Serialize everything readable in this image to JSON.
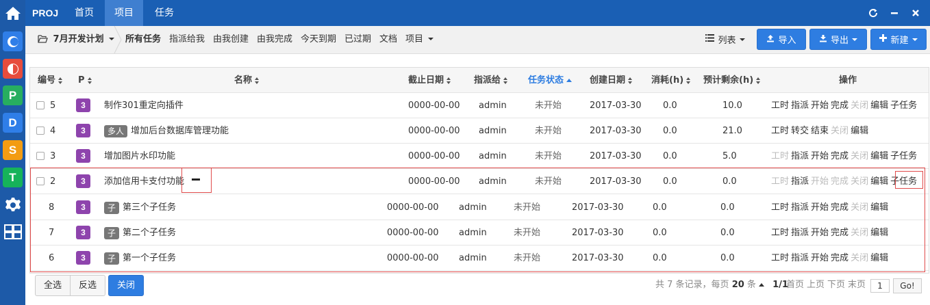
{
  "topbar": {
    "brand": "PROJ",
    "nav": [
      "首页",
      "项目",
      "任务"
    ]
  },
  "subbar": {
    "project": "7月开发计划",
    "tabs": [
      "所有任务",
      "指派给我",
      "由我创建",
      "由我完成",
      "今天到期",
      "已过期",
      "文档",
      "项目"
    ],
    "view": "列表",
    "import": "导入",
    "export": "导出",
    "create": "新建"
  },
  "table": {
    "headers": [
      "编号",
      "P",
      "名称",
      "截止日期",
      "指派给",
      "任务状态",
      "创建日期",
      "消耗(h)",
      "预计剩余(h)",
      "操作"
    ],
    "rows": [
      {
        "id": "5",
        "pri": "3",
        "tag": "",
        "name": "制作301重定向插件",
        "due": "0000-00-00",
        "assignee": "admin",
        "status": "未开始",
        "created": "2017-03-30",
        "spent": "0.0",
        "left": "10.0",
        "actions": [
          {
            "t": "工时",
            "on": true
          },
          {
            "t": "指派",
            "on": true
          },
          {
            "t": "开始",
            "on": true
          },
          {
            "t": "完成",
            "on": true
          },
          {
            "t": "关闭",
            "on": false
          },
          {
            "t": "编辑",
            "on": true
          },
          {
            "t": "子任务",
            "on": true
          }
        ]
      },
      {
        "id": "4",
        "pri": "3",
        "tag": "多人",
        "name": "增加后台数据库管理功能",
        "due": "0000-00-00",
        "assignee": "admin",
        "status": "未开始",
        "created": "2017-03-30",
        "spent": "0.0",
        "left": "21.0",
        "actions": [
          {
            "t": "工时",
            "on": true
          },
          {
            "t": "转交",
            "on": true
          },
          {
            "t": "结束",
            "on": true
          },
          {
            "t": "关闭",
            "on": false
          },
          {
            "t": "编辑",
            "on": true
          }
        ]
      },
      {
        "id": "3",
        "pri": "3",
        "tag": "",
        "name": "增加图片水印功能",
        "due": "0000-00-00",
        "assignee": "admin",
        "status": "未开始",
        "created": "2017-03-30",
        "spent": "0.0",
        "left": "5.0",
        "actions": [
          {
            "t": "工时",
            "on": false
          },
          {
            "t": "指派",
            "on": true
          },
          {
            "t": "开始",
            "on": true
          },
          {
            "t": "完成",
            "on": true
          },
          {
            "t": "关闭",
            "on": false
          },
          {
            "t": "编辑",
            "on": true
          },
          {
            "t": "子任务",
            "on": true
          }
        ]
      },
      {
        "id": "2",
        "pri": "3",
        "tag": "",
        "name": "添加信用卡支付功能",
        "due": "0000-00-00",
        "assignee": "admin",
        "status": "未开始",
        "created": "2017-03-30",
        "spent": "0.0",
        "left": "0.0",
        "actions": [
          {
            "t": "工时",
            "on": false
          },
          {
            "t": "指派",
            "on": true
          },
          {
            "t": "开始",
            "on": false
          },
          {
            "t": "完成",
            "on": false
          },
          {
            "t": "关闭",
            "on": false
          },
          {
            "t": "编辑",
            "on": true
          },
          {
            "t": "子任务",
            "on": true
          }
        ]
      }
    ],
    "subrows": [
      {
        "id": "8",
        "pri": "3",
        "tag": "子",
        "name": "第三个子任务",
        "due": "0000-00-00",
        "assignee": "admin",
        "status": "未开始",
        "created": "2017-03-30",
        "spent": "0.0",
        "left": "0.0",
        "actions": [
          {
            "t": "工时",
            "on": true
          },
          {
            "t": "指派",
            "on": true
          },
          {
            "t": "开始",
            "on": true
          },
          {
            "t": "完成",
            "on": true
          },
          {
            "t": "关闭",
            "on": false
          },
          {
            "t": "编辑",
            "on": true
          }
        ]
      },
      {
        "id": "7",
        "pri": "3",
        "tag": "子",
        "name": "第二个子任务",
        "due": "0000-00-00",
        "assignee": "admin",
        "status": "未开始",
        "created": "2017-03-30",
        "spent": "0.0",
        "left": "0.0",
        "actions": [
          {
            "t": "工时",
            "on": true
          },
          {
            "t": "指派",
            "on": true
          },
          {
            "t": "开始",
            "on": true
          },
          {
            "t": "完成",
            "on": true
          },
          {
            "t": "关闭",
            "on": false
          },
          {
            "t": "编辑",
            "on": true
          }
        ]
      },
      {
        "id": "6",
        "pri": "3",
        "tag": "子",
        "name": "第一个子任务",
        "due": "0000-00-00",
        "assignee": "admin",
        "status": "未开始",
        "created": "2017-03-30",
        "spent": "0.0",
        "left": "0.0",
        "actions": [
          {
            "t": "工时",
            "on": true
          },
          {
            "t": "指派",
            "on": true
          },
          {
            "t": "开始",
            "on": true
          },
          {
            "t": "完成",
            "on": true
          },
          {
            "t": "关闭",
            "on": false
          },
          {
            "t": "编辑",
            "on": true
          }
        ]
      }
    ]
  },
  "footer": {
    "select_all": "全选",
    "invert": "反选",
    "close": "关闭",
    "summary_prefix": "共 7 条记录，每页",
    "per_page": "20",
    "summary_suffix": "条",
    "page_info": "1/1",
    "first": "首页",
    "prev": "上页",
    "next": "下页",
    "last": "末页",
    "page_value": "1",
    "go": "Go!"
  },
  "colors": {
    "rail": "#1d5aa8",
    "topbar": "#1a5fb4",
    "primary": "#2e7de1",
    "priority": "#8e44ad",
    "highlight": "#e04a4a"
  }
}
